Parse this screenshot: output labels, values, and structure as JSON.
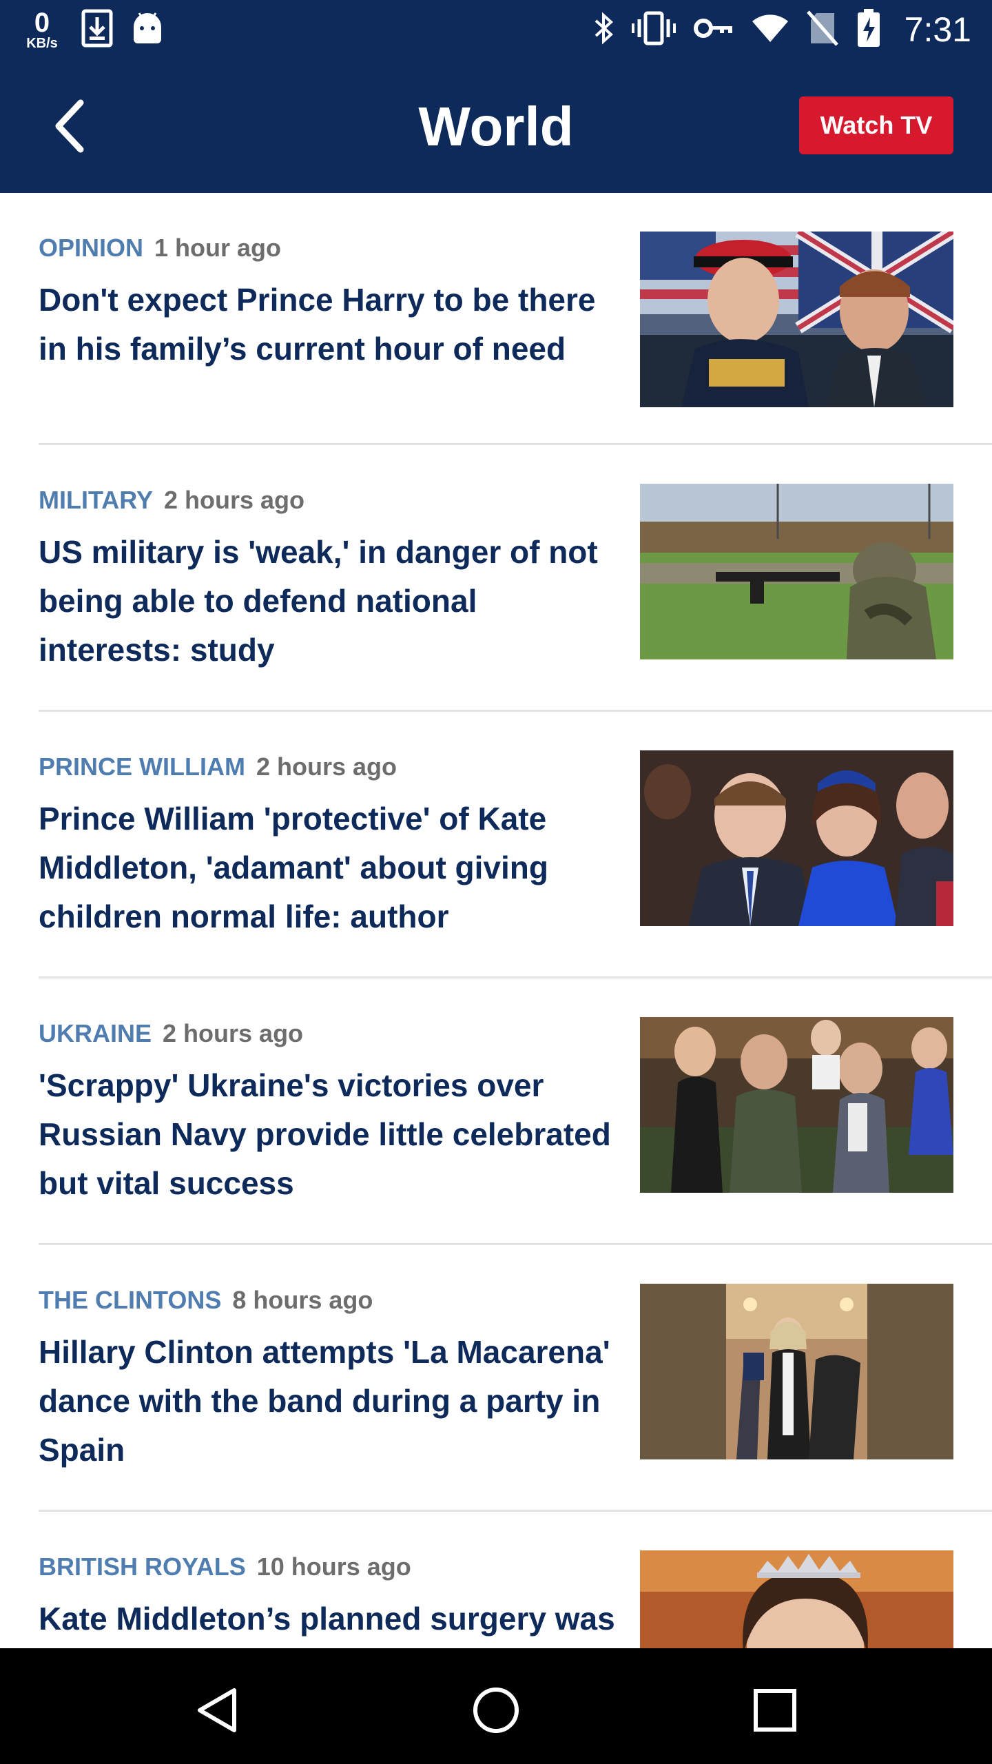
{
  "status_bar": {
    "net_speed_value": "0",
    "net_speed_unit": "KB/s",
    "time": "7:31",
    "icons": [
      "download-icon",
      "android-icon",
      "bluetooth-icon",
      "vibrate-icon",
      "vpn-key-icon",
      "wifi-icon",
      "no-sim-icon",
      "battery-charging-icon"
    ]
  },
  "header": {
    "title": "World",
    "back_icon": "chevron-left-icon",
    "watch_tv_label": "Watch TV"
  },
  "articles": [
    {
      "category": "OPINION",
      "time": "1 hour ago",
      "headline": "Don't expect Prince Harry to be there in his family’s current hour of need"
    },
    {
      "category": "MILITARY",
      "time": "2 hours ago",
      "headline": "US military is 'weak,' in danger of not being able to defend national interests: study"
    },
    {
      "category": "PRINCE WILLIAM",
      "time": "2 hours ago",
      "headline": "Prince William 'protective' of Kate Middleton, 'adamant' about giving children normal life: author"
    },
    {
      "category": "UKRAINE",
      "time": "2 hours ago",
      "headline": "'Scrappy' Ukraine's victories over Russian Navy provide little celebrated but vital success"
    },
    {
      "category": "THE CLINTONS",
      "time": "8 hours ago",
      "headline": "Hillary Clinton attempts 'La Macarena' dance with the band during a party in Spain"
    },
    {
      "category": "BRITISH ROYALS",
      "time": "10 hours ago",
      "headline": "Kate Middleton’s planned surgery was"
    }
  ],
  "nav_bar": {
    "icons": [
      "back-triangle-icon",
      "home-circle-icon",
      "recents-square-icon"
    ]
  },
  "colors": {
    "header_bg": "#0d2a5a",
    "headline": "#0d2a5a",
    "category": "#4f7db0",
    "accent": "#d7192d"
  }
}
